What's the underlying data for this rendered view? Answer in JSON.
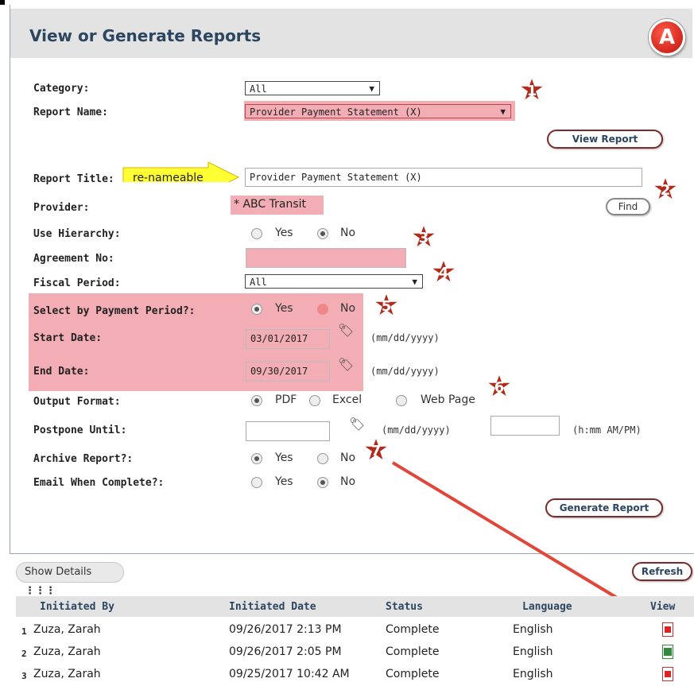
{
  "header": {
    "title": "View or Generate Reports",
    "badge": "A"
  },
  "form": {
    "category": {
      "label": "Category:",
      "value": "All"
    },
    "report_name": {
      "label": "Report Name:",
      "value": "Provider Payment Statement (X)"
    },
    "view_report_button": "View Report",
    "report_title": {
      "label": "Report Title:",
      "value": "Provider Payment Statement (X)"
    },
    "rename_note": "re-nameable",
    "provider": {
      "label": "Provider:",
      "value": "* ABC Transit"
    },
    "find_button": "Find",
    "use_hierarchy": {
      "label": "Use Hierarchy:",
      "yes": "Yes",
      "no": "No",
      "selected": "No"
    },
    "agreement_no": {
      "label": "Agreement No:",
      "value": ""
    },
    "fiscal_period": {
      "label": "Fiscal Period:",
      "value": "All"
    },
    "select_by_payment": {
      "label": "Select by Payment Period?:",
      "yes": "Yes",
      "no": "No",
      "selected": "Yes"
    },
    "start_date": {
      "label": "Start Date:",
      "value": "03/01/2017",
      "hint": "(mm/dd/yyyy)"
    },
    "end_date": {
      "label": "End Date:",
      "value": "09/30/2017",
      "hint": "(mm/dd/yyyy)"
    },
    "output_format": {
      "label": "Output Format:",
      "pdf": "PDF",
      "excel": "Excel",
      "web": "Web Page",
      "selected": "PDF"
    },
    "postpone_until": {
      "label": "Postpone Until:",
      "date_hint": "(mm/dd/yyyy)",
      "time_hint": "(h:mm AM/PM)"
    },
    "archive_report": {
      "label": "Archive Report?:",
      "yes": "Yes",
      "no": "No",
      "selected": "Yes"
    },
    "email_complete": {
      "label": "Email When Complete?:",
      "yes": "Yes",
      "no": "No",
      "selected": "No"
    },
    "generate_button": "Generate Report"
  },
  "callouts": [
    "1",
    "2",
    "3",
    "4",
    "5",
    "6",
    "7"
  ],
  "table": {
    "show_details": "Show Details",
    "refresh": "Refresh",
    "headers": [
      "Initiated By",
      "Initiated Date",
      "Status",
      "Language",
      "View"
    ],
    "rows": [
      {
        "n": "1",
        "by": "Zuza, Zarah",
        "date": "09/26/2017 2:13 PM",
        "status": "Complete",
        "lang": "English",
        "view": "pdf-icon"
      },
      {
        "n": "2",
        "by": "Zuza, Zarah",
        "date": "09/26/2017 2:05 PM",
        "status": "Complete",
        "lang": "English",
        "view": "excel-icon"
      },
      {
        "n": "3",
        "by": "Zuza, Zarah",
        "date": "09/25/2017 10:42 AM",
        "status": "Complete",
        "lang": "English",
        "view": "pdf-icon"
      }
    ]
  },
  "colors": {
    "highlight": "#f2aeb4",
    "title": "#2c4660",
    "callout": "#b22a1a",
    "arrow": "#e0463a",
    "note": "#ffff33"
  }
}
